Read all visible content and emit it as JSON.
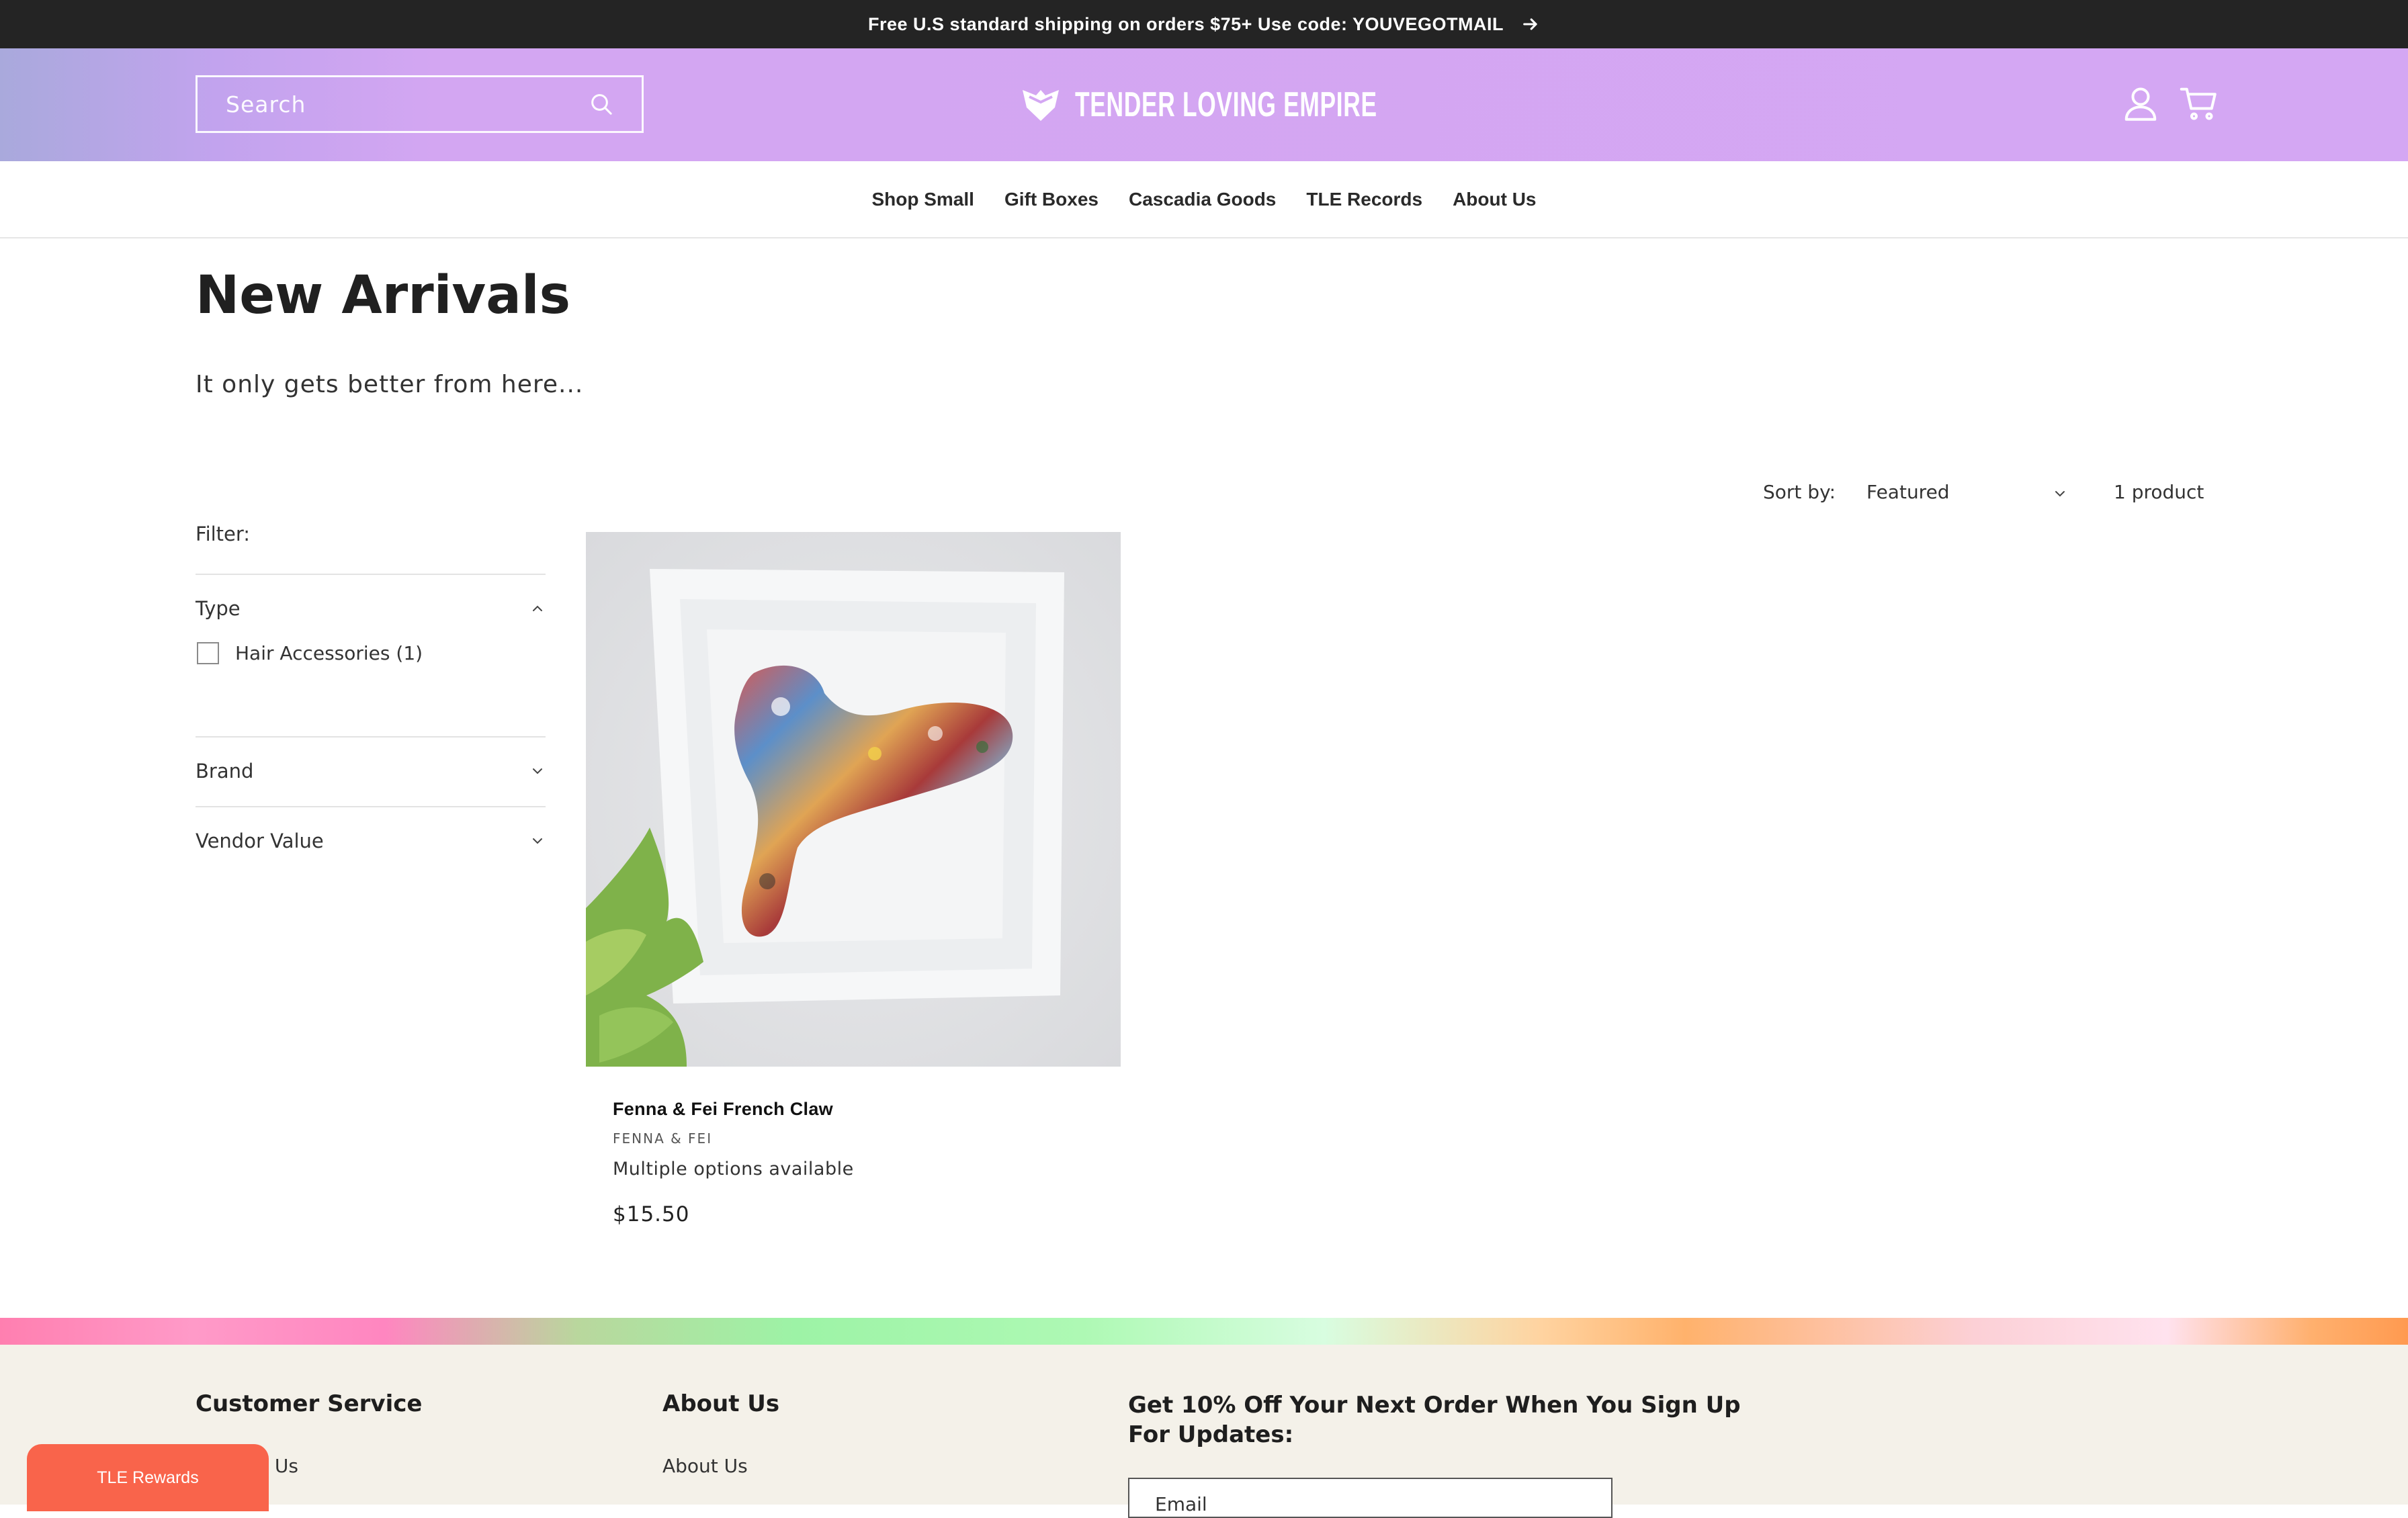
{
  "announcement": {
    "text": "Free U.S standard shipping on orders $75+ Use code: YOUVEGOTMAIL",
    "icon": "arrow-right-icon"
  },
  "header": {
    "search_placeholder": "Search",
    "logo_text": "TENDER LOVING EMPIRE",
    "icons": [
      "search-icon",
      "account-icon",
      "cart-icon"
    ],
    "gradient_colors": [
      "#a9a9dc",
      "#d4a7f3"
    ]
  },
  "nav": {
    "items": [
      "Shop Small",
      "Gift Boxes",
      "Cascadia Goods",
      "TLE Records",
      "About Us"
    ]
  },
  "collection": {
    "title": "New Arrivals",
    "description": "It only gets better from here..."
  },
  "sort": {
    "label": "Sort by:",
    "selected": "Featured",
    "count": "1 product"
  },
  "filters": {
    "label": "Filter:",
    "facets": [
      {
        "name": "Type",
        "expanded": true,
        "options": [
          {
            "label": "Hair Accessories (1)",
            "checked": false
          }
        ]
      },
      {
        "name": "Brand",
        "expanded": false
      },
      {
        "name": "Vendor Value",
        "expanded": false
      }
    ]
  },
  "products": [
    {
      "title": "Fenna & Fei French Claw",
      "vendor": "FENNA & FEI",
      "options_text": "Multiple options available",
      "price": "$15.50"
    }
  ],
  "footer": {
    "col1_heading": "Customer Service",
    "col1_first_link": "Contact Us",
    "col2_heading": "About Us",
    "col2_first_link": "About Us",
    "signup_heading": "Get 10% Off Your Next Order When You Sign Up For Updates:",
    "email_placeholder": "Email"
  },
  "rewards_button": {
    "label": "TLE Rewards",
    "color": "#f9644b"
  }
}
